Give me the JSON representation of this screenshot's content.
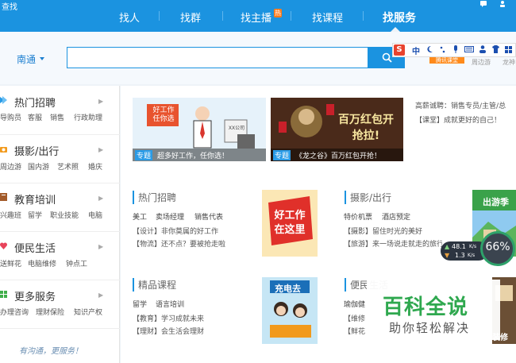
{
  "header": {
    "brand": "查找",
    "nav": [
      {
        "label": "找人"
      },
      {
        "label": "找群"
      },
      {
        "label": "找主播"
      },
      {
        "label": "找课程"
      },
      {
        "label": "找服务"
      }
    ],
    "hot_badge": "热"
  },
  "search": {
    "city": "南通",
    "placeholder": ""
  },
  "ime": {
    "logo": "S",
    "mode": "中",
    "icons": [
      "moon-icon",
      "dot-punct-icon",
      "microphone-icon",
      "keyboard-icon",
      "person-icon",
      "shirt-icon",
      "grid-icon"
    ]
  },
  "top_links": {
    "badge": "腾讯课堂",
    "link1": "周边游",
    "link2": "龙神"
  },
  "sidebar": {
    "categories": [
      {
        "title": "热门招聘",
        "subs": [
          "导购员",
          "客服",
          "销售",
          "行政助理"
        ]
      },
      {
        "title": "摄影/出行",
        "subs": [
          "周边游",
          "国内游",
          "艺术照",
          "婚庆"
        ]
      },
      {
        "title": "教育培训",
        "subs": [
          "兴趣班",
          "留学",
          "职业技能",
          "电脑"
        ]
      },
      {
        "title": "便民生活",
        "subs": [
          "送鲜花",
          "电脑维修",
          "钟点工"
        ]
      },
      {
        "title": "更多服务",
        "subs": [
          "办理咨询",
          "理财保险",
          "知识产权"
        ]
      }
    ],
    "slogan": "有沟通，更服务！"
  },
  "banners": [
    {
      "tag": "专题",
      "caption": "超多好工作，任你选！",
      "art_text": "好工作任你选",
      "sign_text": "XX公司"
    },
    {
      "tag": "专题",
      "caption": "《龙之谷》百万红包开抢！",
      "art_text": "百万红包开抢拉!"
    }
  ],
  "info_lines": [
    "高薪诚聘：销售专员/主管/总",
    "【课堂】成就更好的自己！"
  ],
  "sections": {
    "jobs": {
      "title": "热门招聘",
      "keywords": [
        "美工",
        "卖场经理",
        "销售代表"
      ],
      "lines": [
        "【设计】非你莫属的好工作",
        "【物流】还不点？要被抢走啦"
      ],
      "poster": "好工作在这里"
    },
    "photo": {
      "title": "摄影/出行",
      "keywords": [
        "特价机票",
        "酒店预定"
      ],
      "lines": [
        "【摄影】留住时光的美好",
        "【旅游】来一场说走就走的旅行"
      ],
      "poster": "出游季"
    },
    "courses": {
      "title": "精品课程",
      "keywords": [
        "留学",
        "语言培训"
      ],
      "lines": [
        "【教育】学习成就未来",
        "【理财】会生活会理财"
      ],
      "poster": "充电去"
    },
    "life": {
      "title": "便民生活",
      "keywords": [
        "瑜伽健"
      ],
      "lines": [
        "【维修",
        "【鲜花"
      ],
      "poster": "装修"
    }
  },
  "speed_widget": {
    "up": "48.1",
    "down": "1.3",
    "unit": "K/s",
    "percent": "66%"
  },
  "watermark": {
    "line1": "百科全说",
    "line2": "助你轻松解决"
  }
}
